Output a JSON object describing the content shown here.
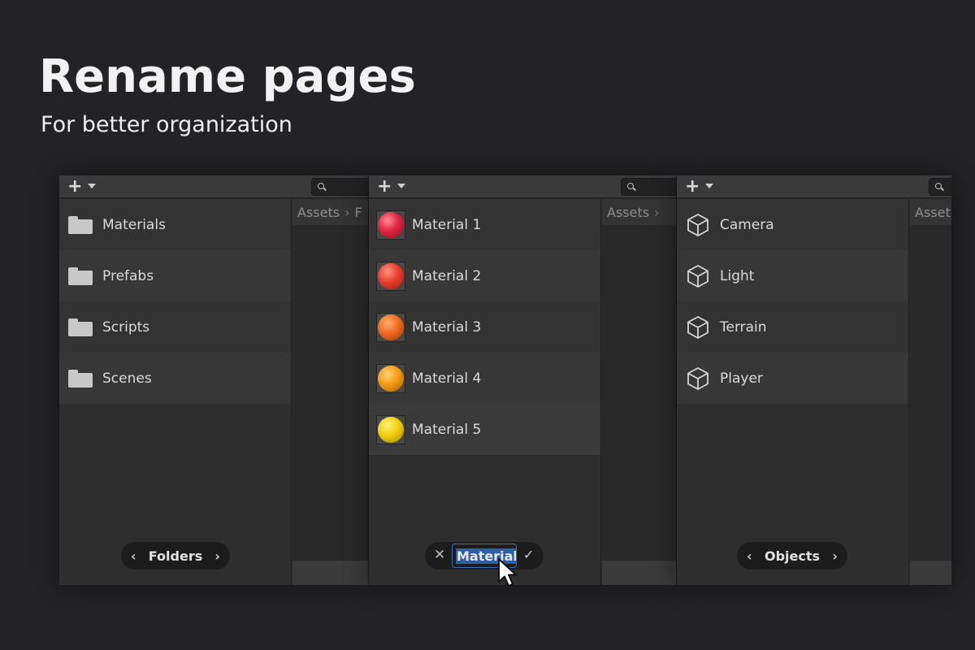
{
  "headline": "Rename pages",
  "subline": "For better organization",
  "panels": [
    {
      "breadcrumb": [
        "Assets",
        "F"
      ],
      "items": [
        {
          "label": "Materials",
          "icon": "folder-icon"
        },
        {
          "label": "Prefabs",
          "icon": "folder-icon"
        },
        {
          "label": "Scripts",
          "icon": "folder-icon"
        },
        {
          "label": "Scenes",
          "icon": "folder-icon"
        }
      ],
      "page_name": "Folders"
    },
    {
      "breadcrumb": [
        "Assets"
      ],
      "items": [
        {
          "label": "Material 1",
          "icon": "material-sphere-icon",
          "color": "#e0243f"
        },
        {
          "label": "Material 2",
          "icon": "material-sphere-icon",
          "color": "#ea3d2c"
        },
        {
          "label": "Material 3",
          "icon": "material-sphere-icon",
          "color": "#f06a20"
        },
        {
          "label": "Material 4",
          "icon": "material-sphere-icon",
          "color": "#f59a12"
        },
        {
          "label": "Material 5",
          "icon": "material-sphere-icon",
          "color": "#f2cf0c"
        }
      ],
      "rename_value": "Materials"
    },
    {
      "breadcrumb": [
        "Asset"
      ],
      "items": [
        {
          "label": "Camera",
          "icon": "cube-icon"
        },
        {
          "label": "Light",
          "icon": "cube-icon"
        },
        {
          "label": "Terrain",
          "icon": "cube-icon"
        },
        {
          "label": "Player",
          "icon": "cube-icon"
        }
      ],
      "page_name": "Objects"
    }
  ],
  "glyphs": {
    "plus": "+",
    "chevron_left": "‹",
    "chevron_right": "›",
    "breadcrumb_sep": "›",
    "cancel": "✕",
    "confirm": "✓"
  },
  "colors": {
    "background": "#232325",
    "selection": "#2f5ea8",
    "input_border": "#3d6fbf"
  }
}
